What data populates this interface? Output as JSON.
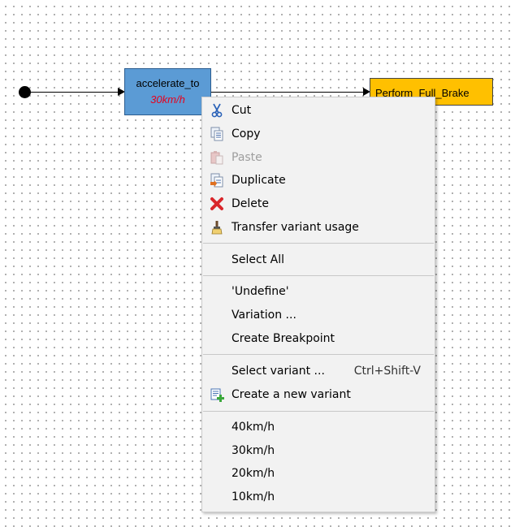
{
  "diagram": {
    "states": [
      {
        "name": "accelerate_to",
        "variant": "30km/h"
      },
      {
        "name": "Perform_Full_Brake"
      }
    ]
  },
  "context_menu": {
    "items": [
      {
        "label": "Cut",
        "icon": "scissors-icon",
        "enabled": true
      },
      {
        "label": "Copy",
        "icon": "copy-icon",
        "enabled": true
      },
      {
        "label": "Paste",
        "icon": "paste-icon",
        "enabled": false
      },
      {
        "label": "Duplicate",
        "icon": "duplicate-icon",
        "enabled": true
      },
      {
        "label": "Delete",
        "icon": "delete-icon",
        "enabled": true
      },
      {
        "label": "Transfer variant usage",
        "icon": "brush-icon",
        "enabled": true
      },
      {
        "label": "Select All",
        "enabled": true
      },
      {
        "label": "'Undefine'",
        "enabled": true
      },
      {
        "label": "Variation ...",
        "enabled": true
      },
      {
        "label": "Create Breakpoint",
        "enabled": true
      },
      {
        "label": "Select variant ...",
        "shortcut": "Ctrl+Shift-V",
        "enabled": true
      },
      {
        "label": "Create a new variant",
        "icon": "new-variant-icon",
        "enabled": true
      },
      {
        "label": "40km/h",
        "enabled": true
      },
      {
        "label": "30km/h",
        "enabled": true
      },
      {
        "label": "20km/h",
        "enabled": true
      },
      {
        "label": "10km/h",
        "enabled": true
      }
    ]
  },
  "colors": {
    "state_blue": "#5b9bd5",
    "state_yellow": "#ffc000",
    "variant_red": "#e8001c"
  }
}
